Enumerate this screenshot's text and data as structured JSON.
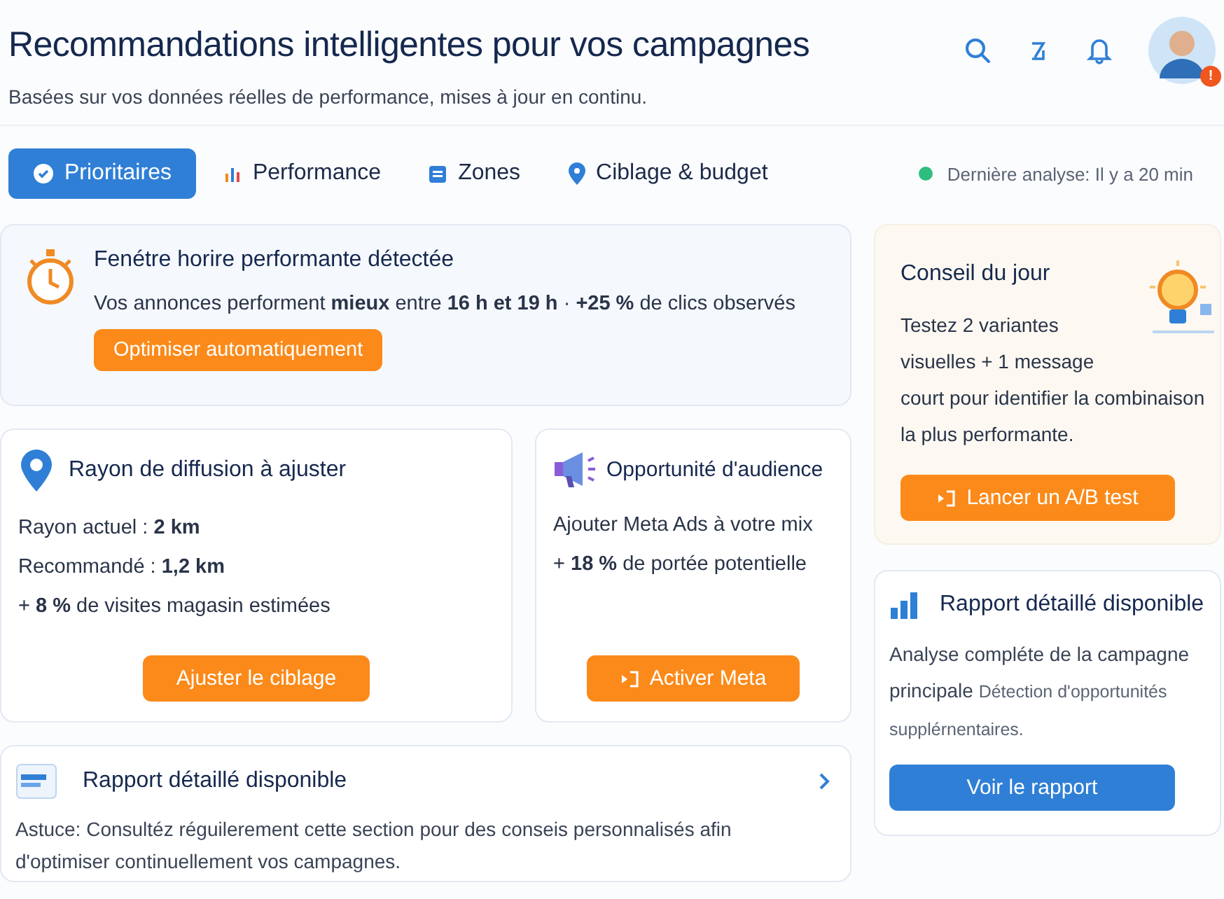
{
  "header": {
    "title": "Recommandations intelligentes pour vos campagnes",
    "subtitle": "Basées sur vos données réelles de performance, mises à jour en continu.",
    "badge": "!"
  },
  "tabs": [
    {
      "label": "Prioritaires",
      "kind": "check",
      "selected": true
    },
    {
      "label": "Performance",
      "kind": "chart",
      "selected": false
    },
    {
      "label": "Zones",
      "kind": "square",
      "selected": false
    },
    {
      "label": "Ciblage & budget",
      "kind": "pin",
      "selected": false
    }
  ],
  "status": {
    "text": "Dernière analyse: Il y a 20 min",
    "color": "#2ebd7f"
  },
  "alert": {
    "title": "Fenétre horire performante détectée",
    "text": "Vos annonces performent **mieux** entre **16 h et 19 h** · **+25 %** de clics observés",
    "button": "Optimiser automatiquement"
  },
  "radius": {
    "title": "Rayon de diffusion à ajuster",
    "lines": [
      "Rayon actuel :  **2 km**",
      "Recommandé :  **1,2 km**",
      "+ **8 %** de visites magasin estimées"
    ],
    "button": "Ajuster le ciblage"
  },
  "audience": {
    "title": "Opportunité d'audience",
    "lines": [
      "Ajouter Meta Ads à votre mix",
      "+ **18 %** de portée potentielle"
    ],
    "button": "Activer Meta"
  },
  "tip": {
    "title": "Conseil du jour",
    "text": "Testez 2 variantes visuelles + 1 message court pour identifier la combinaison la plus performante.",
    "button": "Lancer un A/B test"
  },
  "report": {
    "title": "Rapport détaillé disponible",
    "text": "Analyse compléte de la campagne principale",
    "note": "Détection d'opportunités supplérnentaires.",
    "button": "Voir le rapport"
  },
  "footer": {
    "title": "Rapport détaillé disponible",
    "text": "Astuce: Consultéz réguilerement cette section pour des conseis personnalisés afin d'optimiser continuellement vos campagnes."
  }
}
